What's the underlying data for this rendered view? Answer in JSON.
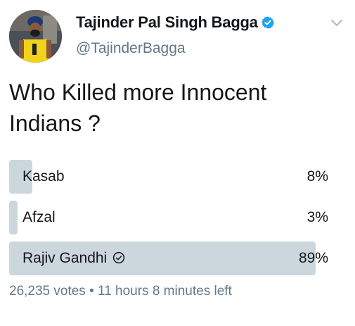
{
  "tweet": {
    "author_name": "Tajinder Pal Singh Bagga",
    "handle": "@TajinderBagga",
    "text": "Who Killed more Innocent Indians ?",
    "icons": {
      "verified": "verified-badge-icon",
      "menu": "chevron-down-icon",
      "selected": "check-circle-icon"
    },
    "colors": {
      "accent": "#1da1f2",
      "bar": "#ccd6dd",
      "muted": "#657786"
    }
  },
  "poll": {
    "options": [
      {
        "label": "Kasab",
        "percent_label": "8%",
        "percent": 8,
        "selected": false
      },
      {
        "label": "Afzal",
        "percent_label": "3%",
        "percent": 3,
        "selected": false
      },
      {
        "label": "Rajiv Gandhi",
        "percent_label": "89%",
        "percent": 89,
        "selected": true
      }
    ],
    "votes": "26,235 votes",
    "separator": "•",
    "time_left": "11 hours 8 minutes left"
  }
}
